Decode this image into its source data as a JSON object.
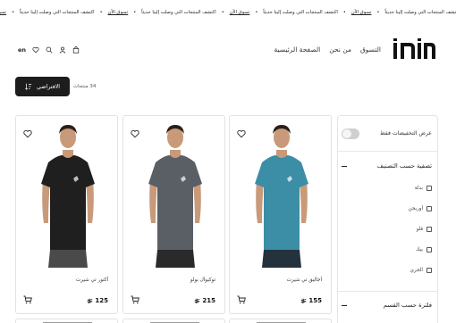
{
  "marquee": {
    "items": [
      {
        "text": "اكتشف المنتجات التي وصلت إلينا حديثاً",
        "link": false
      },
      {
        "text": "تسوق الآن",
        "link": true
      },
      {
        "text": "اكتشف المنتجات التي وصلت إلينا حديثاً",
        "link": false
      },
      {
        "text": "تسوق الآن",
        "link": true
      },
      {
        "text": "اكتشف المنتجات التي وصلت إلينا حديثاً",
        "link": false
      },
      {
        "text": "تسوق الآن",
        "link": true
      },
      {
        "text": "اكتشف المنتجات التي وصلت إلينا حديثاً",
        "link": false
      },
      {
        "text": "تسوق الآن",
        "link": true
      },
      {
        "text": "اكتشف المنتجات التي وصلت إلينا حديثاً",
        "link": false
      }
    ]
  },
  "header": {
    "logo_text": "inin",
    "nav": [
      "الصفحة الرئيسية",
      "من نحن",
      "التسوق"
    ],
    "lang": "en",
    "icons": [
      "heart-icon",
      "search-icon",
      "user-icon",
      "bag-icon"
    ]
  },
  "toolbar": {
    "sort_label": "الافتراضي",
    "count": "34 منتجات"
  },
  "filters": {
    "discount_label": "عرض التخفيضات فقط",
    "discount_on": false,
    "section1_title": "تصفية حسب التصنيف",
    "options": [
      "بدلة",
      "أوريجن",
      "قلو",
      "بيك",
      "الجري"
    ],
    "section2_title": "فلترة حسب القسم"
  },
  "products": [
    {
      "name": "أجاليق تي شيرت",
      "price": "155",
      "shirt_color": "#3b8ea5",
      "shorts_color": "#23323d"
    },
    {
      "name": "توكيوال بولو",
      "price": "215",
      "shirt_color": "#5a5f66",
      "shorts_color": "#2a2a2a"
    },
    {
      "name": "أكتور تي شيرت",
      "price": "125",
      "shirt_color": "#1f1f1f",
      "shorts_color": "#4a4a4a"
    }
  ],
  "colors": {
    "accent": "#1d1d1d",
    "skin": "#c89a7a",
    "hair": "#2b1f18"
  }
}
